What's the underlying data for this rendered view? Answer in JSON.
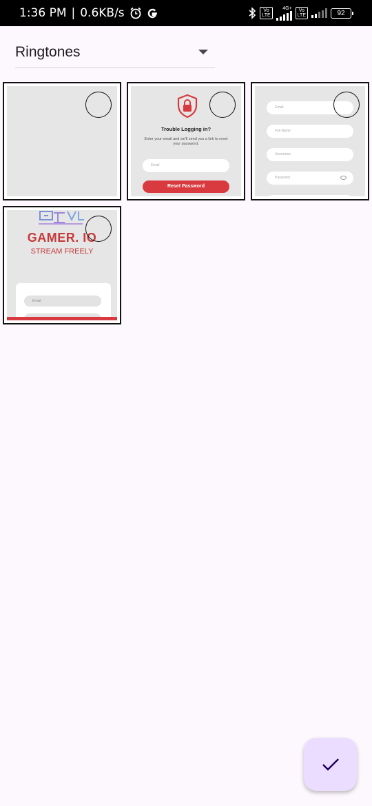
{
  "status_bar": {
    "time": "1:36 PM",
    "speed": "0.6KB/s",
    "network_label": "4G+",
    "volte_top": "Vo",
    "volte_bottom": "LTE",
    "battery": "92"
  },
  "dropdown": {
    "selected": "Ringtones"
  },
  "tiles": {
    "t2": {
      "title": "Trouble Logging in?",
      "description": "Enter your email and we'll send you a link to reset your password.",
      "email_placeholder": "Email",
      "button_label": "Reset Password"
    },
    "t3": {
      "fields": [
        "Email",
        "Full Name",
        "Username",
        "Password"
      ]
    },
    "t4": {
      "brand": "GAMER. IO",
      "tagline": "STREAM FREELY",
      "email_placeholder": "Email"
    }
  },
  "fab": {
    "icon": "check-icon"
  },
  "colors": {
    "accent_red": "#d93a3f",
    "fab_bg": "#eaddff",
    "fab_icon": "#21005d",
    "background": "#fdf8fd"
  }
}
